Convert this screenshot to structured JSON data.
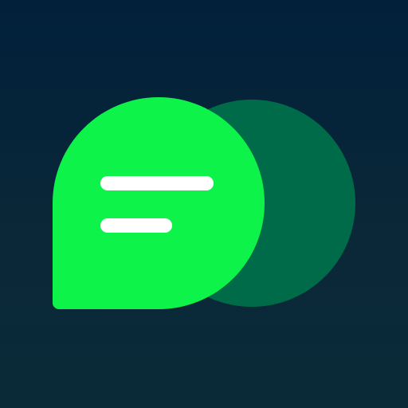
{
  "icon": {
    "name": "chat-bubbles-icon",
    "colors": {
      "background_top": "#01203a",
      "background_bottom": "#0a2a38",
      "front_bubble": "#0ef34a",
      "back_bubble": "#006b49",
      "text_lines": "#ffffff"
    }
  }
}
